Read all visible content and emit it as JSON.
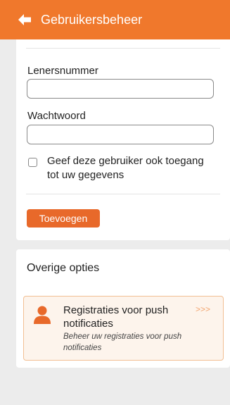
{
  "header": {
    "title": "Gebruikersbeheer",
    "back_icon": "arrow-left-icon"
  },
  "form": {
    "lenersnummer_label": "Lenersnummer",
    "lenersnummer_value": "",
    "wachtwoord_label": "Wachtwoord",
    "wachtwoord_value": "",
    "share_checkbox_checked": false,
    "share_checkbox_label": "Geef deze gebruiker ook toegang tot uw gegevens",
    "add_button_label": "Toevoegen"
  },
  "options": {
    "title": "Overige opties",
    "items": [
      {
        "icon": "person-icon",
        "title": "Registraties voor push notificaties",
        "subtitle": "Beheer uw registraties voor push notificaties",
        "arrow": ">>>"
      }
    ]
  },
  "colors": {
    "accent": "#f0782c",
    "button": "#e8692a",
    "item_border": "#f2bf93",
    "item_background": "#fdf4ec",
    "background": "#ececec"
  }
}
